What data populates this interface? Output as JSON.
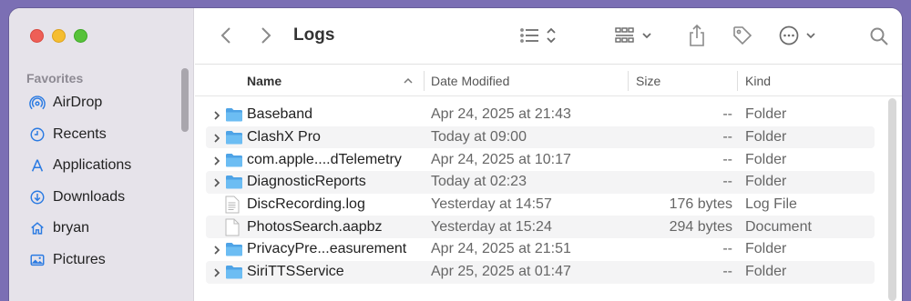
{
  "window": {
    "title": "Logs"
  },
  "colors": {
    "folder": "#5eb2ee",
    "sidebar_icon": "#2a7ae2",
    "desktop": "#7b6fb4"
  },
  "sidebar": {
    "section_label": "Favorites",
    "items": [
      {
        "label": "AirDrop",
        "icon": "airdrop-icon"
      },
      {
        "label": "Recents",
        "icon": "clock-icon"
      },
      {
        "label": "Applications",
        "icon": "applications-icon"
      },
      {
        "label": "Downloads",
        "icon": "download-icon"
      },
      {
        "label": "bryan",
        "icon": "home-icon"
      },
      {
        "label": "Pictures",
        "icon": "photo-icon"
      }
    ]
  },
  "toolbar": {
    "back_icon": "chevron-left-icon",
    "forward_icon": "chevron-right-icon",
    "view_icon": "list-view-icon",
    "group_icon": "grid-group-icon",
    "share_icon": "share-icon",
    "tag_icon": "tag-icon",
    "more_icon": "ellipsis-circle-icon",
    "search_icon": "search-icon"
  },
  "columns": {
    "name": "Name",
    "date": "Date Modified",
    "size": "Size",
    "kind": "Kind"
  },
  "files": [
    {
      "name": "Baseband",
      "date": "Apr 24, 2025 at 21:43",
      "size": "--",
      "kind": "Folder",
      "type": "folder"
    },
    {
      "name": "ClashX Pro",
      "date": "Today at 09:00",
      "size": "--",
      "kind": "Folder",
      "type": "folder"
    },
    {
      "name": "com.apple....dTelemetry",
      "date": "Apr 24, 2025 at 10:17",
      "size": "--",
      "kind": "Folder",
      "type": "folder"
    },
    {
      "name": "DiagnosticReports",
      "date": "Today at 02:23",
      "size": "--",
      "kind": "Folder",
      "type": "folder"
    },
    {
      "name": "DiscRecording.log",
      "date": "Yesterday at 14:57",
      "size": "176 bytes",
      "kind": "Log File",
      "type": "log"
    },
    {
      "name": "PhotosSearch.aapbz",
      "date": "Yesterday at 15:24",
      "size": "294 bytes",
      "kind": "Document",
      "type": "document"
    },
    {
      "name": "PrivacyPre...easurement",
      "date": "Apr 24, 2025 at 21:51",
      "size": "--",
      "kind": "Folder",
      "type": "folder"
    },
    {
      "name": "SiriTTSService",
      "date": "Apr 25, 2025 at 01:47",
      "size": "--",
      "kind": "Folder",
      "type": "folder"
    }
  ]
}
